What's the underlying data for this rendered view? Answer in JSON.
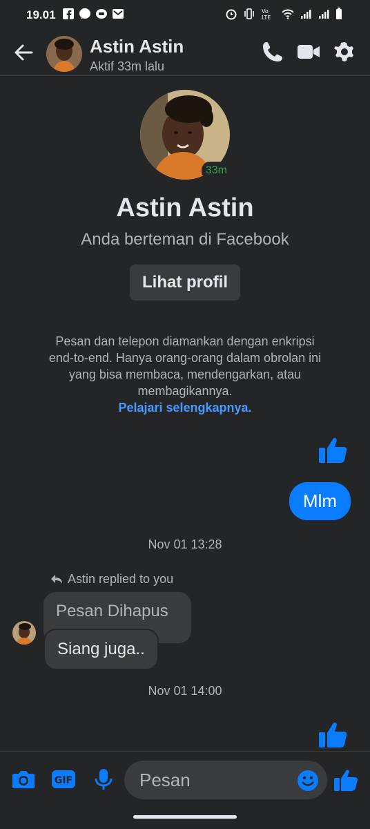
{
  "status_bar": {
    "time": "19.01",
    "notification_icons": [
      "facebook-icon",
      "messenger-icon",
      "message-icon",
      "gmail-icon"
    ],
    "system_icons": [
      "alarm-icon",
      "vibrate-icon",
      "volte-icon",
      "wifi-icon",
      "signal-icon",
      "signal-icon",
      "battery-icon"
    ]
  },
  "header": {
    "name": "Astin Astin",
    "status": "Aktif 33m lalu"
  },
  "profile": {
    "active_badge": "33m",
    "name": "Astin Astin",
    "friends_text": "Anda berteman di Facebook",
    "view_profile_label": "Lihat profil"
  },
  "encryption": {
    "text": "Pesan dan telepon diamankan dengan enkripsi end-to-end. Hanya orang-orang dalam obrolan ini yang bisa membaca, mendengarkan, atau membagikannya.",
    "link": "Pelajari selengkapnya."
  },
  "messages": {
    "outgoing_text": "Mlm",
    "timestamp_1": "Nov 01 13:28",
    "replied_label": "Astin replied to you",
    "quoted_text": "Pesan Dihapus",
    "incoming_text": "Siang juga..",
    "timestamp_2": "Nov 01 14:00"
  },
  "composer": {
    "placeholder": "Pesan"
  },
  "colors": {
    "background": "#242526",
    "accent": "#0a7cff",
    "link": "#4599ff",
    "active_green": "#31a24c"
  }
}
